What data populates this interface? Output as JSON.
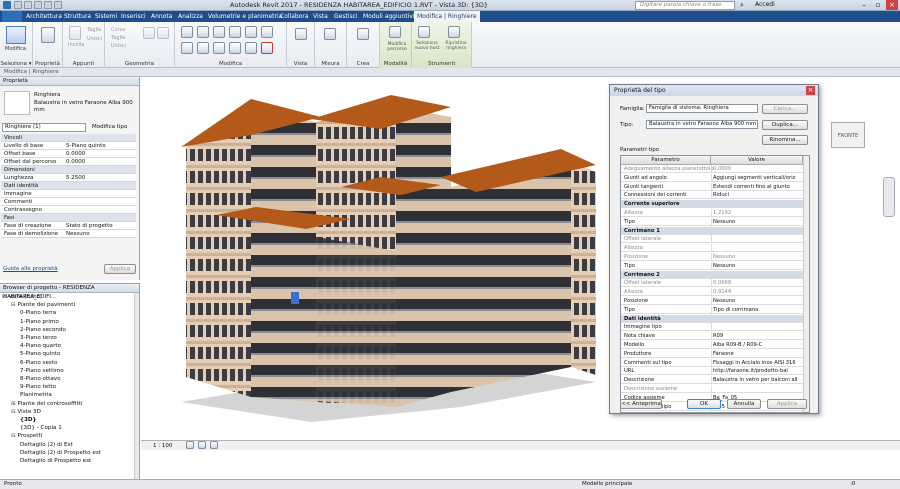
{
  "title_bar": {
    "title": "Autodesk Revit 2017 -   RESIDENZA HABITAREA_EDIFICIO 1.RVT - Vista 3D: {3D}",
    "search_placeholder": "Digitare parola chiave o frase",
    "signin": "Accedi"
  },
  "menu_tabs": [
    "Architettura",
    "Struttura",
    "Sistemi",
    "Inserisci",
    "Annota",
    "Analizza",
    "Volumetrie e planimetria",
    "Collabora",
    "Vista",
    "Gestisci",
    "Moduli aggiuntivi",
    "Modifica | Ringhiere"
  ],
  "ribbon": {
    "groups": [
      "Seleziona ▾",
      "Proprietà",
      "Appunti",
      "Geometria",
      "Modifica",
      "Vista",
      "Misura",
      "Crea",
      "Modalità",
      "Strumenti"
    ],
    "modify_label": "Modifica",
    "paste_label": "Incolla",
    "clipboard_items": [
      "Taglia",
      "Unisci"
    ],
    "cut_label": "Corsa",
    "edit_path_label": "Modifica percorso",
    "select_host_label": "Seleziona nuovo host",
    "reset_label": "Ripristina ringhiera"
  },
  "context_bar": "Modifica | Ringhiere",
  "properties": {
    "header": "Proprietà",
    "type_family": "Ringhiera",
    "type_name": "Balaustra in vetro Faraone Alba 900 mm",
    "filter": "Ringhiere (1)",
    "edit_type": "Modifica tipo",
    "rows": [
      {
        "k": "Vincoli",
        "v": "",
        "cat": true
      },
      {
        "k": "Livello di base",
        "v": "5-Piano quinto"
      },
      {
        "k": "Offset base",
        "v": "0.0000"
      },
      {
        "k": "Offset dal percorso",
        "v": "0.0000"
      },
      {
        "k": "Dimensioni",
        "v": "",
        "cat": true
      },
      {
        "k": "Lunghezza",
        "v": "5.2500"
      },
      {
        "k": "Dati identità",
        "v": "",
        "cat": true
      },
      {
        "k": "Immagine",
        "v": ""
      },
      {
        "k": "Commenti",
        "v": ""
      },
      {
        "k": "Contrassegno",
        "v": ""
      },
      {
        "k": "Fasi",
        "v": "",
        "cat": true
      },
      {
        "k": "Fase di creazione",
        "v": "Stato di progetto"
      },
      {
        "k": "Fase di demolizione",
        "v": "Nessuno"
      }
    ],
    "help_link": "Guida alle proprietà",
    "apply": "Applica"
  },
  "browser": {
    "header": "Browser di progetto - RESIDENZA HABITAREA_EDIFI...",
    "items": [
      {
        "t": "Viste (tutto)",
        "lvl": 0,
        "pre": "⊟-[0]"
      },
      {
        "t": "Piante dei pavimenti",
        "lvl": 1,
        "pre": "⊟"
      },
      {
        "t": "0-Piano terra",
        "lvl": 2
      },
      {
        "t": "1-Piano primo",
        "lvl": 2
      },
      {
        "t": "2-Piano secondo",
        "lvl": 2
      },
      {
        "t": "3-Piano terzo",
        "lvl": 2
      },
      {
        "t": "4-Piano quarto",
        "lvl": 2
      },
      {
        "t": "5-Piano quinto",
        "lvl": 2
      },
      {
        "t": "6-Piano sesto",
        "lvl": 2
      },
      {
        "t": "7-Piano settimo",
        "lvl": 2
      },
      {
        "t": "8-Piano ottavo",
        "lvl": 2
      },
      {
        "t": "9-Piano tetto",
        "lvl": 2
      },
      {
        "t": "Planimetria",
        "lvl": 2
      },
      {
        "t": "Piante dei controsoffitti",
        "lvl": 1,
        "pre": "⊞"
      },
      {
        "t": "Viste 3D",
        "lvl": 1,
        "pre": "⊟"
      },
      {
        "t": "{3D}",
        "lvl": 2,
        "bold": true
      },
      {
        "t": "{3D} - Copia 1",
        "lvl": 2
      },
      {
        "t": "Prospetti",
        "lvl": 1,
        "pre": "⊟"
      },
      {
        "t": "Dettaglio (2) di Est",
        "lvl": 2
      },
      {
        "t": "Dettaglio (2) di Prospetto est",
        "lvl": 2
      },
      {
        "t": "Dettaglio di Prospetto est",
        "lvl": 2
      }
    ]
  },
  "view_bar": {
    "scale": "1 : 100"
  },
  "viewcube_label": "FRONTE",
  "status_bar": {
    "left": "Pronto",
    "model": "Modello principale",
    "filter_count": ":0"
  },
  "dialog": {
    "title": "Proprietà del tipo",
    "family_label": "Famiglia:",
    "family_value": "Famiglia di sistema: Ringhiera",
    "type_label": "Tipo:",
    "type_value": "Balaustra in vetro Faraone Alba 900 mm",
    "load_btn": "Carica...",
    "duplicate_btn": "Duplica...",
    "rename_btn": "Rinomina...",
    "params_label": "Parametri tipo",
    "col_param": "Parametro",
    "col_value": "Valore",
    "rows": [
      {
        "k": "Adeguamento altezza pianerottolo",
        "v": "0.0000",
        "dim": true
      },
      {
        "k": "Giunti ad angolo",
        "v": "Aggiungi segmenti verticali/oriz"
      },
      {
        "k": "Giunti tangenti",
        "v": "Estendi correnti fino al giunto"
      },
      {
        "k": "Connessioni dei correnti",
        "v": "Riduci"
      },
      {
        "k": "Corrente superiore",
        "v": "",
        "grp": true
      },
      {
        "k": "Altezza",
        "v": "1.2192",
        "dim": true
      },
      {
        "k": "Tipo",
        "v": "Nessuno"
      },
      {
        "k": "Corrimano 1",
        "v": "",
        "grp": true
      },
      {
        "k": "Offset laterale",
        "v": "",
        "dim": true
      },
      {
        "k": "Altezza",
        "v": "",
        "dim": true
      },
      {
        "k": "Posizione",
        "v": "Nessuno",
        "dim": true
      },
      {
        "k": "Tipo",
        "v": "Nessuno"
      },
      {
        "k": "Corrimano 2",
        "v": "",
        "grp": true
      },
      {
        "k": "Offset laterale",
        "v": "0.0668",
        "dim": true
      },
      {
        "k": "Altezza",
        "v": "0.9144",
        "dim": true
      },
      {
        "k": "Posizione",
        "v": "Nessuno"
      },
      {
        "k": "Tipo",
        "v": "Tipo di corrimano"
      },
      {
        "k": "Dati identità",
        "v": "",
        "grp": true
      },
      {
        "k": "Immagine tipo",
        "v": ""
      },
      {
        "k": "Nota chiave",
        "v": "R09"
      },
      {
        "k": "Modello",
        "v": "Alba R09-B / R09-C"
      },
      {
        "k": "Produttore",
        "v": "Faraone"
      },
      {
        "k": "Commenti sul tipo",
        "v": "Fissaggi in Acciaio inox AISI 316"
      },
      {
        "k": "URL",
        "v": "http://faraone.it/prodotto-bal"
      },
      {
        "k": "Descrizione",
        "v": "Balaustra in vetro per balconi all"
      },
      {
        "k": "Descrizione assieme",
        "v": "",
        "dim": true
      },
      {
        "k": "Codice assieme",
        "v": "Ba_Fa_05"
      },
      {
        "k": "Contrassegno tipo",
        "v": "B/05"
      }
    ],
    "preview_btn": "<< Anteprima",
    "ok_btn": "OK",
    "cancel_btn": "Annulla",
    "apply_btn": "Applica"
  },
  "colors": {
    "menubar": "#1f4e8c",
    "roof": "#b35a1a",
    "facade": "#e6cdb4",
    "dark_panels": "#2e3036"
  }
}
